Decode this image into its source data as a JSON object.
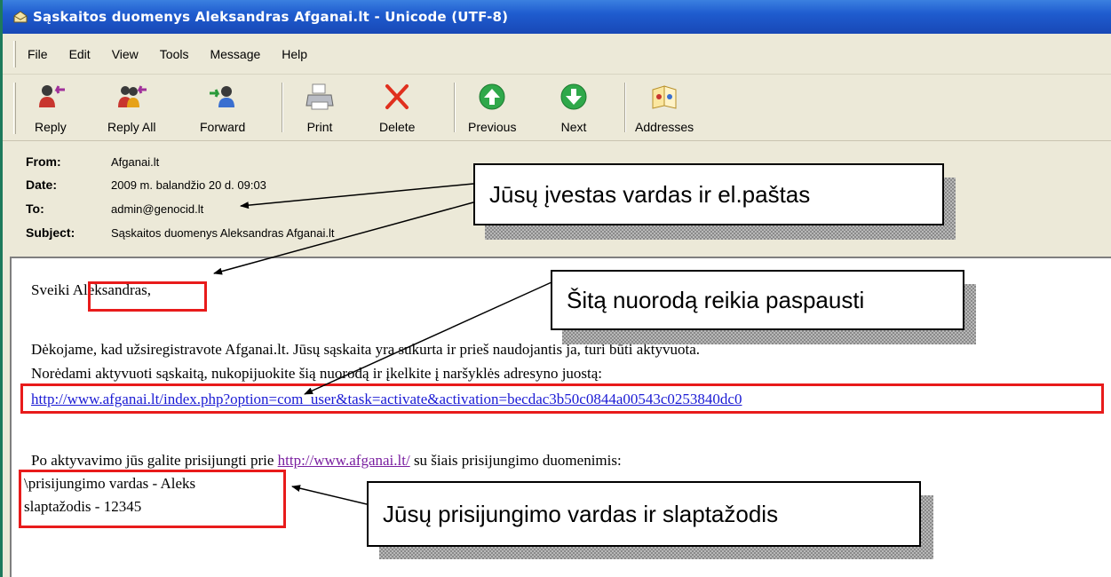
{
  "window": {
    "title": "Sąskaitos duomenys Aleksandras  Afganai.lt - Unicode (UTF-8)"
  },
  "menu": [
    "File",
    "Edit",
    "View",
    "Tools",
    "Message",
    "Help"
  ],
  "toolbar": {
    "reply": "Reply",
    "reply_all": "Reply All",
    "forward": "Forward",
    "print": "Print",
    "delete": "Delete",
    "previous": "Previous",
    "next": "Next",
    "addresses": "Addresses"
  },
  "header": {
    "from_label": "From:",
    "from_value": "Afganai.lt",
    "date_label": "Date:",
    "date_value": "2009 m. balandžio 20 d. 09:03",
    "to_label": "To:",
    "to_value": "admin@genocid.lt",
    "subject_label": "Subject:",
    "subject_value": "Sąskaitos duomenys Aleksandras  Afganai.lt"
  },
  "body": {
    "greeting_prefix": "Sveiki ",
    "greeting_name": "Aleksandras,",
    "line1": "Dėkojame, kad užsiregistravote Afganai.lt. Jūsų sąskaita yra sukurta ir prieš naudojantis ja, turi būti aktyvuota.",
    "line2": " Norėdami aktyvuoti sąskaitą, nukopijuokite šią nuorodą ir įkelkite į naršyklės adresyno juostą:",
    "activation_link": "http://www.afganai.lt/index.php?option=com_user&task=activate&activation=becdac3b50c0844a00543c0253840dc0",
    "line3_prefix": "Po aktyvavimo jūs galite prisijungti prie ",
    "site_link": "http://www.afganai.lt/",
    "line3_suffix": " su šiais prisijungimo duomenimis:",
    "username_line": "\\prisijungimo vardas - Aleks",
    "password_line": "slaptažodis - 12345"
  },
  "callouts": {
    "name_email": "Jūsų įvestas vardas ir el.paštas",
    "link_note": "Šitą nuorodą reikia paspausti",
    "credentials": "Jūsų prisijungimo vardas ir slaptažodis"
  },
  "colors": {
    "titlebar": "#1f5ccf",
    "highlight_box": "#e81b1b",
    "link": "#1a1ad4",
    "visited_link": "#7a1fa0"
  }
}
